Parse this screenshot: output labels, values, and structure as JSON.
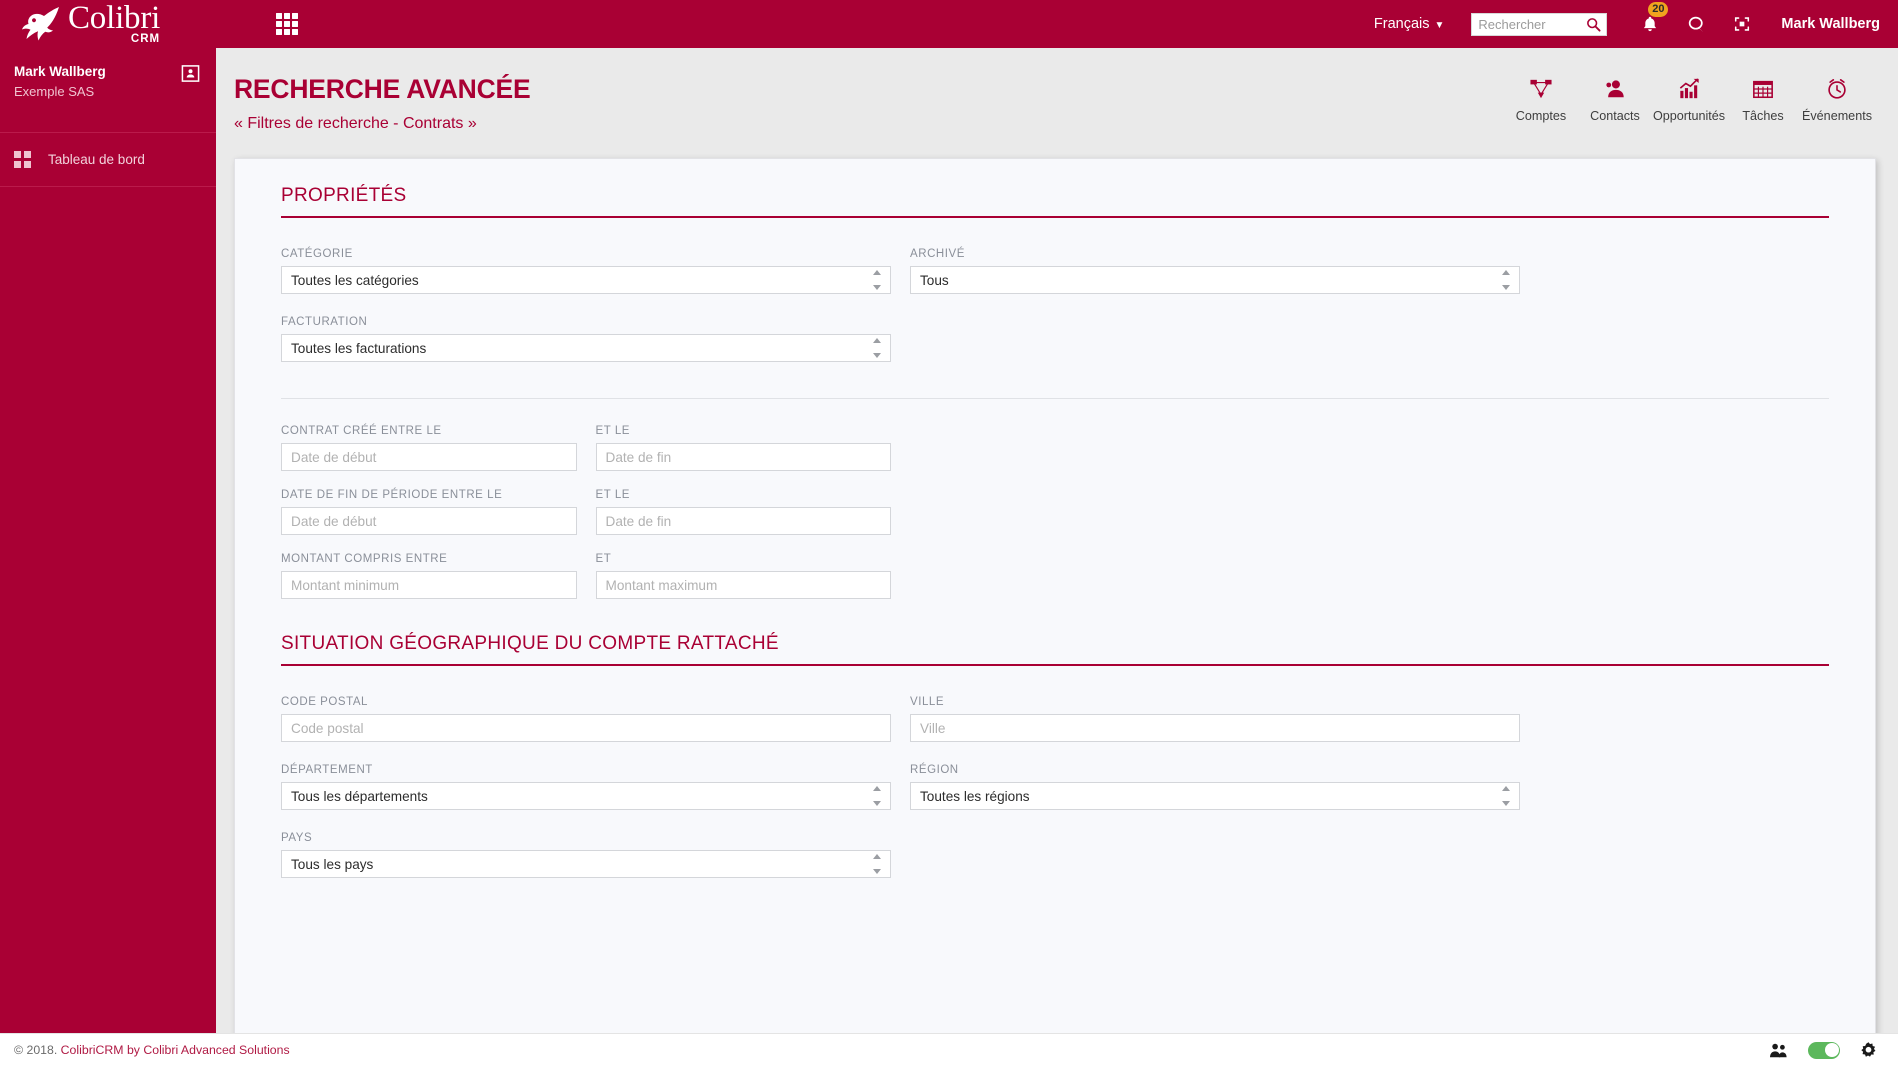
{
  "topbar": {
    "brand_name": "Colibri",
    "brand_sub": "CRM",
    "apps_icon": "grid-apps-icon",
    "language": "Français",
    "language_chevron": "chevron-down-icon",
    "search_placeholder": "Rechercher",
    "search_value": "",
    "search_icon": "search-icon",
    "notifications_icon": "bell-icon",
    "notifications_count": "20",
    "messages_icon": "chat-bubble-icon",
    "fullscreen_icon": "fullscreen-icon",
    "username": "Mark Wallberg",
    "accent_color": "#a90034",
    "badge_color": "#f0a41e"
  },
  "sidebar": {
    "user_name": "Mark Wallberg",
    "user_org": "Exemple SAS",
    "card_icon": "contact-card-icon",
    "items": [
      {
        "label": "Tableau de bord",
        "icon": "dashboard-grid-icon"
      }
    ]
  },
  "page": {
    "title": "RECHERCHE AVANCÉE",
    "subtitle": "« Filtres de recherche - Contrats »"
  },
  "quicknav": [
    {
      "label": "Comptes",
      "icon": "accounts-network-icon"
    },
    {
      "label": "Contacts",
      "icon": "contact-person-icon"
    },
    {
      "label": "Opportunités",
      "icon": "chart-growth-icon"
    },
    {
      "label": "Tâches",
      "icon": "calendar-icon"
    },
    {
      "label": "Événements",
      "icon": "alarm-clock-icon"
    }
  ],
  "sections": [
    {
      "title": "PROPRIÉTÉS",
      "fields": {
        "categorie_label": "CATÉGORIE",
        "categorie_value": "Toutes les catégories",
        "archive_label": "ARCHIVÉ",
        "archive_value": "Tous",
        "facturation_label": "FACTURATION",
        "facturation_value": "Toutes les facturations",
        "contrat_cree_label": "CONTRAT CRÉÉ ENTRE LE",
        "contrat_cree_placeholder": "Date de début",
        "contrat_cree_et_label": "ET LE",
        "contrat_cree_et_placeholder": "Date de fin",
        "date_fin_periode_label": "DATE DE FIN DE PÉRIODE ENTRE LE",
        "date_fin_periode_placeholder": "Date de début",
        "date_fin_periode_et_label": "ET LE",
        "date_fin_periode_et_placeholder": "Date de fin",
        "montant_label": "MONTANT COMPRIS ENTRE",
        "montant_placeholder": "Montant minimum",
        "montant_et_label": "ET",
        "montant_et_placeholder": "Montant maximum"
      }
    },
    {
      "title": "SITUATION GÉOGRAPHIQUE DU COMPTE RATTACHÉ",
      "fields": {
        "code_postal_label": "CODE POSTAL",
        "code_postal_placeholder": "Code postal",
        "ville_label": "VILLE",
        "ville_placeholder": "Ville",
        "departement_label": "DÉPARTEMENT",
        "departement_value": "Tous les départements",
        "region_label": "RÉGION",
        "region_value": "Toutes les régions",
        "pays_label": "PAYS",
        "pays_value": "Tous les pays"
      }
    }
  ],
  "footer": {
    "copyright_prefix": "© 2018. ",
    "copyright_link": "ColibriCRM by Colibri Advanced Solutions",
    "users_icon": "users-group-icon",
    "toggle_state": "on",
    "toggle_color": "#5cb85c",
    "settings_icon": "gear-icon"
  }
}
